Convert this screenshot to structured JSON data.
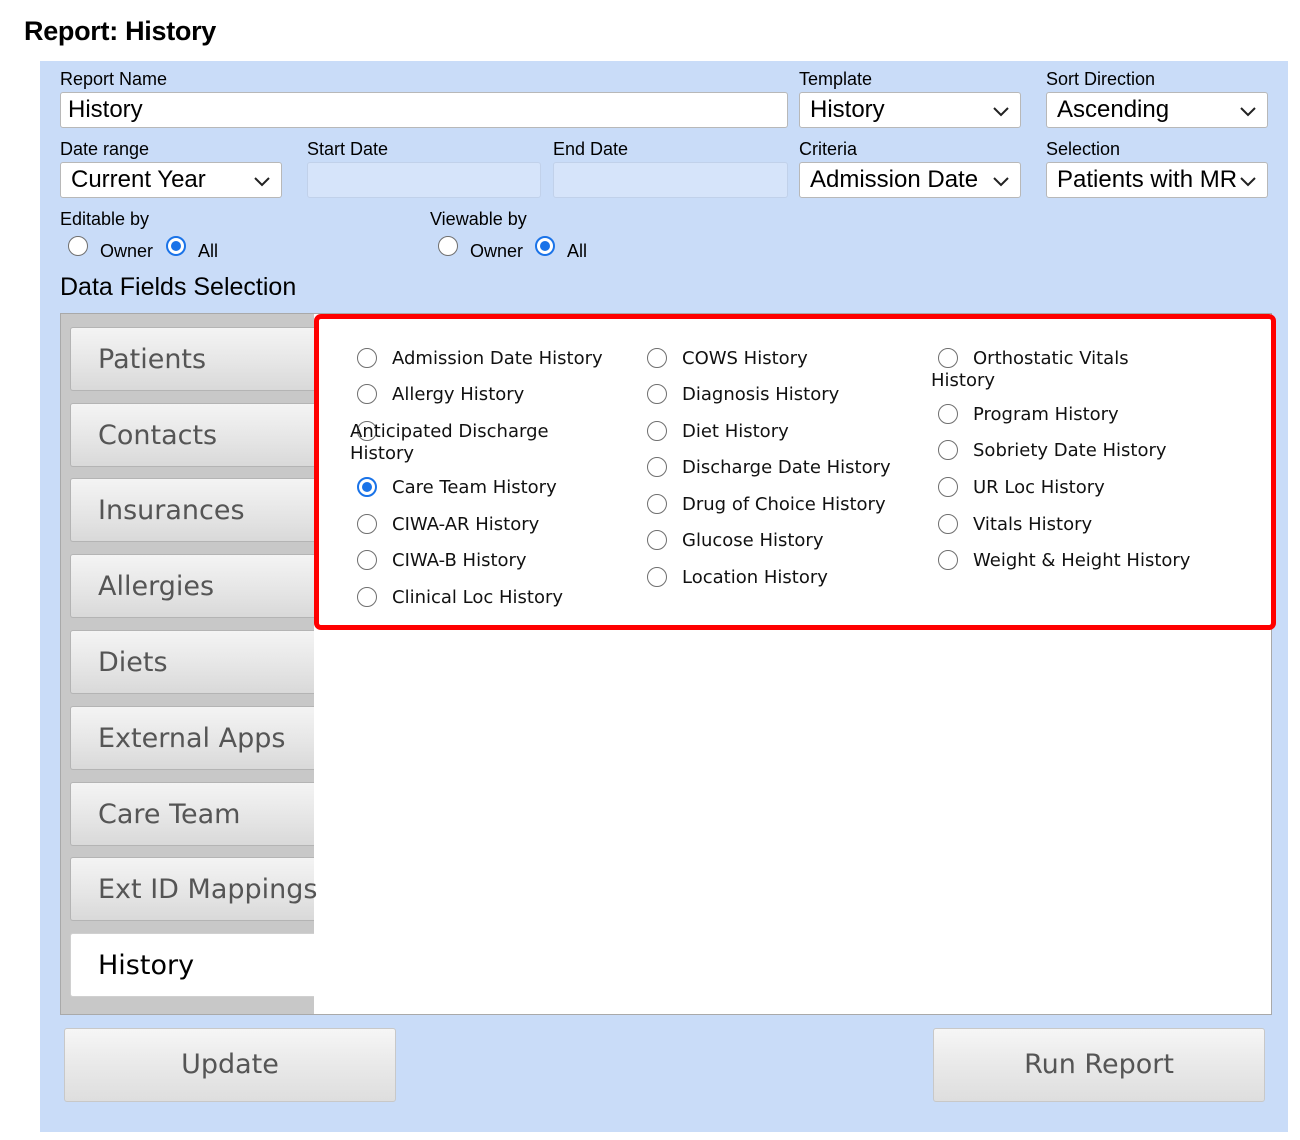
{
  "page": {
    "title": "Report: History"
  },
  "form": {
    "report_name": {
      "label": "Report Name",
      "value": "History"
    },
    "template": {
      "label": "Template",
      "value": "History"
    },
    "sort_direction": {
      "label": "Sort Direction",
      "value": "Ascending"
    },
    "date_range": {
      "label": "Date range",
      "value": "Current Year"
    },
    "start_date": {
      "label": "Start Date",
      "value": ""
    },
    "end_date": {
      "label": "End Date",
      "value": ""
    },
    "criteria": {
      "label": "Criteria",
      "value": "Admission Date"
    },
    "selection": {
      "label": "Selection",
      "value": "Patients with MR"
    },
    "editable_by": {
      "label": "Editable by",
      "options": [
        "Owner",
        "All"
      ],
      "selected": "All"
    },
    "viewable_by": {
      "label": "Viewable by",
      "options": [
        "Owner",
        "All"
      ],
      "selected": "All"
    }
  },
  "data_fields": {
    "title": "Data Fields Selection",
    "tabs": [
      "Patients",
      "Contacts",
      "Insurances",
      "Allergies",
      "Diets",
      "External Apps",
      "Care Team",
      "Ext ID Mappings",
      "History"
    ],
    "active_tab": "History",
    "columns": [
      [
        "Admission Date History",
        "Allergy History",
        "Anticipated Discharge History",
        "Care Team History",
        "CIWA-AR History",
        "CIWA-B History",
        "Clinical Loc History"
      ],
      [
        "COWS History",
        "Diagnosis History",
        "Diet History",
        "Discharge Date History",
        "Drug of Choice History",
        "Glucose History",
        "Location History"
      ],
      [
        "Orthostatic Vitals History",
        "Program History",
        "Sobriety Date History",
        "UR Loc History",
        "Vitals History",
        "Weight & Height History"
      ]
    ],
    "selected_field": "Care Team History"
  },
  "actions": {
    "update_label": "Update",
    "run_label": "Run Report"
  },
  "colors": {
    "panel": "#c9dcf8",
    "highlight_border": "#ff0000",
    "radio_checked": "#1a73e8"
  },
  "icons": {
    "select": "chevron-down-icon"
  }
}
